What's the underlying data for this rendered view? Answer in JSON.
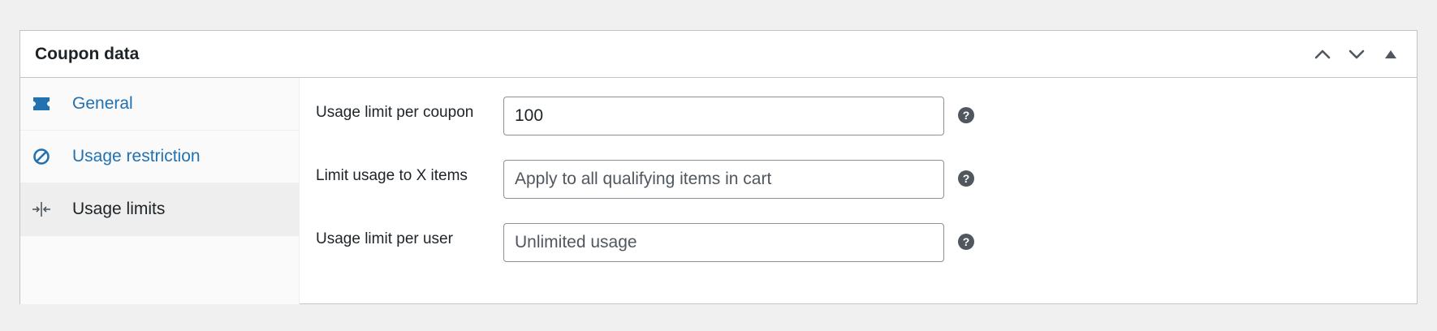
{
  "panel": {
    "title": "Coupon data",
    "controls": {
      "move_up_icon": "chevron-up-icon",
      "move_down_icon": "chevron-down-icon",
      "toggle_icon": "triangle-up-icon"
    }
  },
  "tabs": [
    {
      "label": "General",
      "icon": "ticket-icon",
      "active": false
    },
    {
      "label": "Usage restriction",
      "icon": "prohibited-icon",
      "active": false
    },
    {
      "label": "Usage limits",
      "icon": "collapse-horizontal-icon",
      "active": true
    }
  ],
  "fields": [
    {
      "label": "Usage limit per coupon",
      "value": "100",
      "placeholder": ""
    },
    {
      "label": "Limit usage to X items",
      "value": "",
      "placeholder": "Apply to all qualifying items in cart"
    },
    {
      "label": "Usage limit per user",
      "value": "",
      "placeholder": "Unlimited usage"
    }
  ],
  "help_glyph": "?",
  "colors": {
    "link": "#2271b1",
    "text": "#1d2327",
    "border": "#c3c4c7",
    "background": "#f0f0f1"
  }
}
